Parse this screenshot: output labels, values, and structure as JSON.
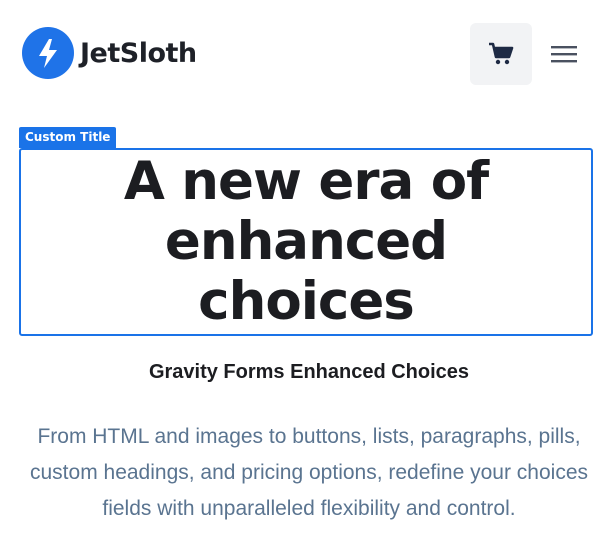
{
  "header": {
    "logo_text": "JetSloth",
    "logo_icon": "lightning-bolt-icon",
    "cart_icon": "cart-icon",
    "menu_icon": "hamburger-menu-icon",
    "brand_color": "#1f73e8"
  },
  "editor": {
    "tag_label": "Custom Title",
    "accent_color": "#1a73e8"
  },
  "hero": {
    "title": "A new era of enhanced choices",
    "subtitle": "Gravity Forms Enhanced Choices",
    "description": "From HTML and images to buttons, lists, paragraphs, pills, custom headings, and pricing options, redefine your choices fields with unparalleled flexibility and control."
  }
}
